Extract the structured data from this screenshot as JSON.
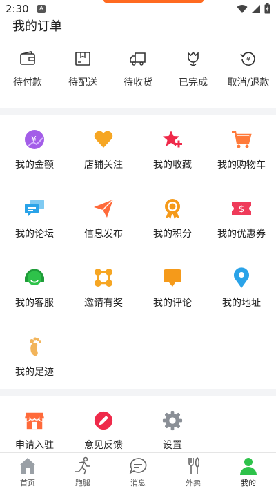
{
  "status": {
    "time": "2:30",
    "notif_letter": "A"
  },
  "orders": {
    "title": "我的订单",
    "items": [
      {
        "label": "待付款",
        "icon": "wallet-icon"
      },
      {
        "label": "待配送",
        "icon": "package-icon"
      },
      {
        "label": "待收货",
        "icon": "truck-icon"
      },
      {
        "label": "已完成",
        "icon": "tulip-icon"
      },
      {
        "label": "取消/退款",
        "icon": "refund-icon"
      }
    ]
  },
  "services": [
    {
      "label": "我的金额",
      "icon": "yen-coin-icon",
      "color": "#a35de8"
    },
    {
      "label": "店铺关注",
      "icon": "heart-icon",
      "color": "#f6a623"
    },
    {
      "label": "我的收藏",
      "icon": "star-plus-icon",
      "color": "#ef2a4a"
    },
    {
      "label": "我的购物车",
      "icon": "cart-icon",
      "color": "#ff7a3a"
    },
    {
      "label": "我的论坛",
      "icon": "chat-bubbles-icon",
      "color": "#2aa3e8"
    },
    {
      "label": "信息发布",
      "icon": "paper-plane-icon",
      "color": "#ff6a3a"
    },
    {
      "label": "我的积分",
      "icon": "medal-icon",
      "color": "#f59a1a"
    },
    {
      "label": "我的优惠券",
      "icon": "coupon-icon",
      "color": "#ef3b5a"
    },
    {
      "label": "我的客服",
      "icon": "headset-icon",
      "color": "#2ec24a"
    },
    {
      "label": "邀请有奖",
      "icon": "nodes-icon",
      "color": "#f6a623"
    },
    {
      "label": "我的评论",
      "icon": "comment-icon",
      "color": "#f59a1a"
    },
    {
      "label": "我的地址",
      "icon": "location-pin-icon",
      "color": "#2aa3e8"
    },
    {
      "label": "我的足迹",
      "icon": "footprint-icon",
      "color": "#f2b45a"
    }
  ],
  "settings": [
    {
      "label": "申请入驻",
      "icon": "shop-icon",
      "color": "#ff6a3a"
    },
    {
      "label": "意见反馈",
      "icon": "pen-circle-icon",
      "color": "#ef2a4a"
    },
    {
      "label": "设置",
      "icon": "gear-icon",
      "color": "#8a8f96"
    }
  ],
  "tabs": [
    {
      "label": "首页",
      "icon": "home-icon"
    },
    {
      "label": "跑腿",
      "icon": "runner-icon"
    },
    {
      "label": "消息",
      "icon": "message-icon"
    },
    {
      "label": "外卖",
      "icon": "cutlery-icon"
    },
    {
      "label": "我的",
      "icon": "person-icon",
      "active": true,
      "color": "#2ec24a"
    }
  ]
}
